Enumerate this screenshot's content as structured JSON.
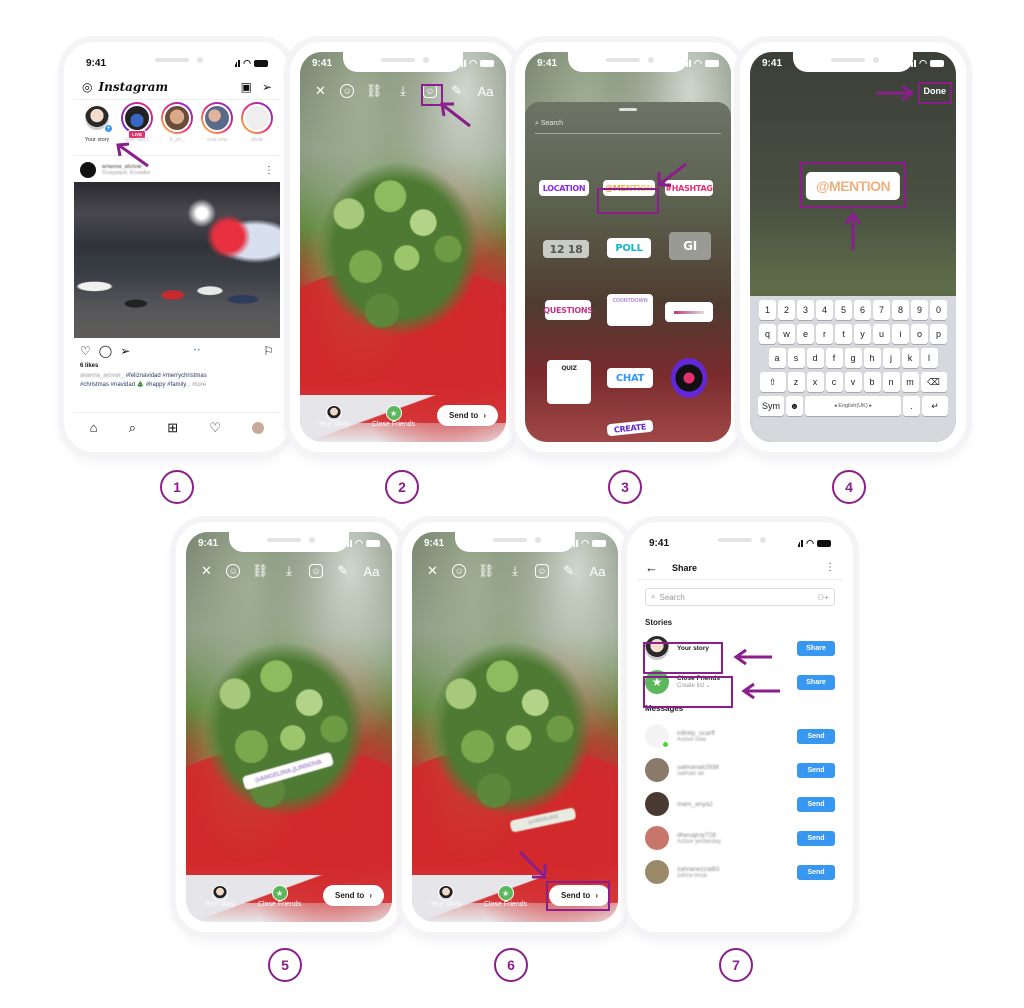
{
  "accent_color": "#8a1f8c",
  "status_time": "9:41",
  "steps": [
    "1",
    "2",
    "3",
    "4",
    "5",
    "6",
    "7"
  ],
  "phone1": {
    "app_title": "Instagram",
    "stories": [
      {
        "label": "Your story",
        "own": true
      },
      {
        "label": "user 9821",
        "live": true
      },
      {
        "label": "d_jm_"
      },
      {
        "label": "nua.ona"
      },
      {
        "label": "dbvb"
      }
    ],
    "live_badge": "LIVE",
    "post_user": "arianna_alcivar_",
    "post_location": "Guayaquil, Ecuador",
    "likes": "6 likes",
    "caption_user": "arianna_alcivar_",
    "caption_text_1": "#feliznavidad #merrychristmas",
    "caption_text_2": "#christmas #navidad 🎄 #happy #family",
    "caption_more": "... more"
  },
  "story_editor": {
    "tools": [
      "close-icon",
      "face-filter-icon",
      "link-icon",
      "download-icon",
      "sticker-icon",
      "draw-icon",
      "text-icon"
    ],
    "text_tool_label": "Aa",
    "your_story": "Your story",
    "close_friends": "Close Friends",
    "send_to": "Send to"
  },
  "phone3": {
    "search_placeholder": "Search",
    "stickers": {
      "location": "LOCATION",
      "mention": "@MENTION",
      "hashtag": "#HASHTAG",
      "time": "12 18",
      "poll": "POLL",
      "gif": "GI",
      "questions": "QUESTIONS",
      "countdown": "COUNTDOWN",
      "quiz": "QUIZ",
      "chat": "CHAT",
      "create": "CREATE"
    }
  },
  "phone4": {
    "done_label": "Done",
    "mention_text": "@MENTION",
    "keyboard": {
      "row_numbers": [
        "1",
        "2",
        "3",
        "4",
        "5",
        "6",
        "7",
        "8",
        "9",
        "0"
      ],
      "row1": [
        "q",
        "w",
        "e",
        "r",
        "t",
        "y",
        "u",
        "i",
        "o",
        "p"
      ],
      "row2": [
        "a",
        "s",
        "d",
        "f",
        "g",
        "h",
        "j",
        "k",
        "l"
      ],
      "row3": [
        "z",
        "x",
        "c",
        "v",
        "b",
        "n",
        "m"
      ],
      "sym": "Sym",
      "space": "◂ English(UK) ▸",
      "period": "."
    }
  },
  "phone5": {
    "mention_sticker": "@ANGELINA.JLINNOVA"
  },
  "phone6": {
    "mention_sticker": "@ANGELINA"
  },
  "phone7": {
    "title": "Share",
    "search_placeholder": "Search",
    "stories_label": "Stories",
    "your_story": "Your story",
    "close_friends": "Close Friends",
    "create_list": "Create list ⌄",
    "share_label": "Share",
    "messages_label": "Messages",
    "send_label": "Send",
    "messages": [
      {
        "name": "infinity_scarff",
        "sub": "Active now",
        "active": true
      },
      {
        "name": "salmanali2838",
        "sub": "salman ali"
      },
      {
        "name": "mam_anya2",
        "sub": ""
      },
      {
        "name": "dhesajroy728",
        "sub": "Active yesterday"
      },
      {
        "name": "zahranezzal83",
        "sub": "zahra-rezai"
      }
    ]
  }
}
